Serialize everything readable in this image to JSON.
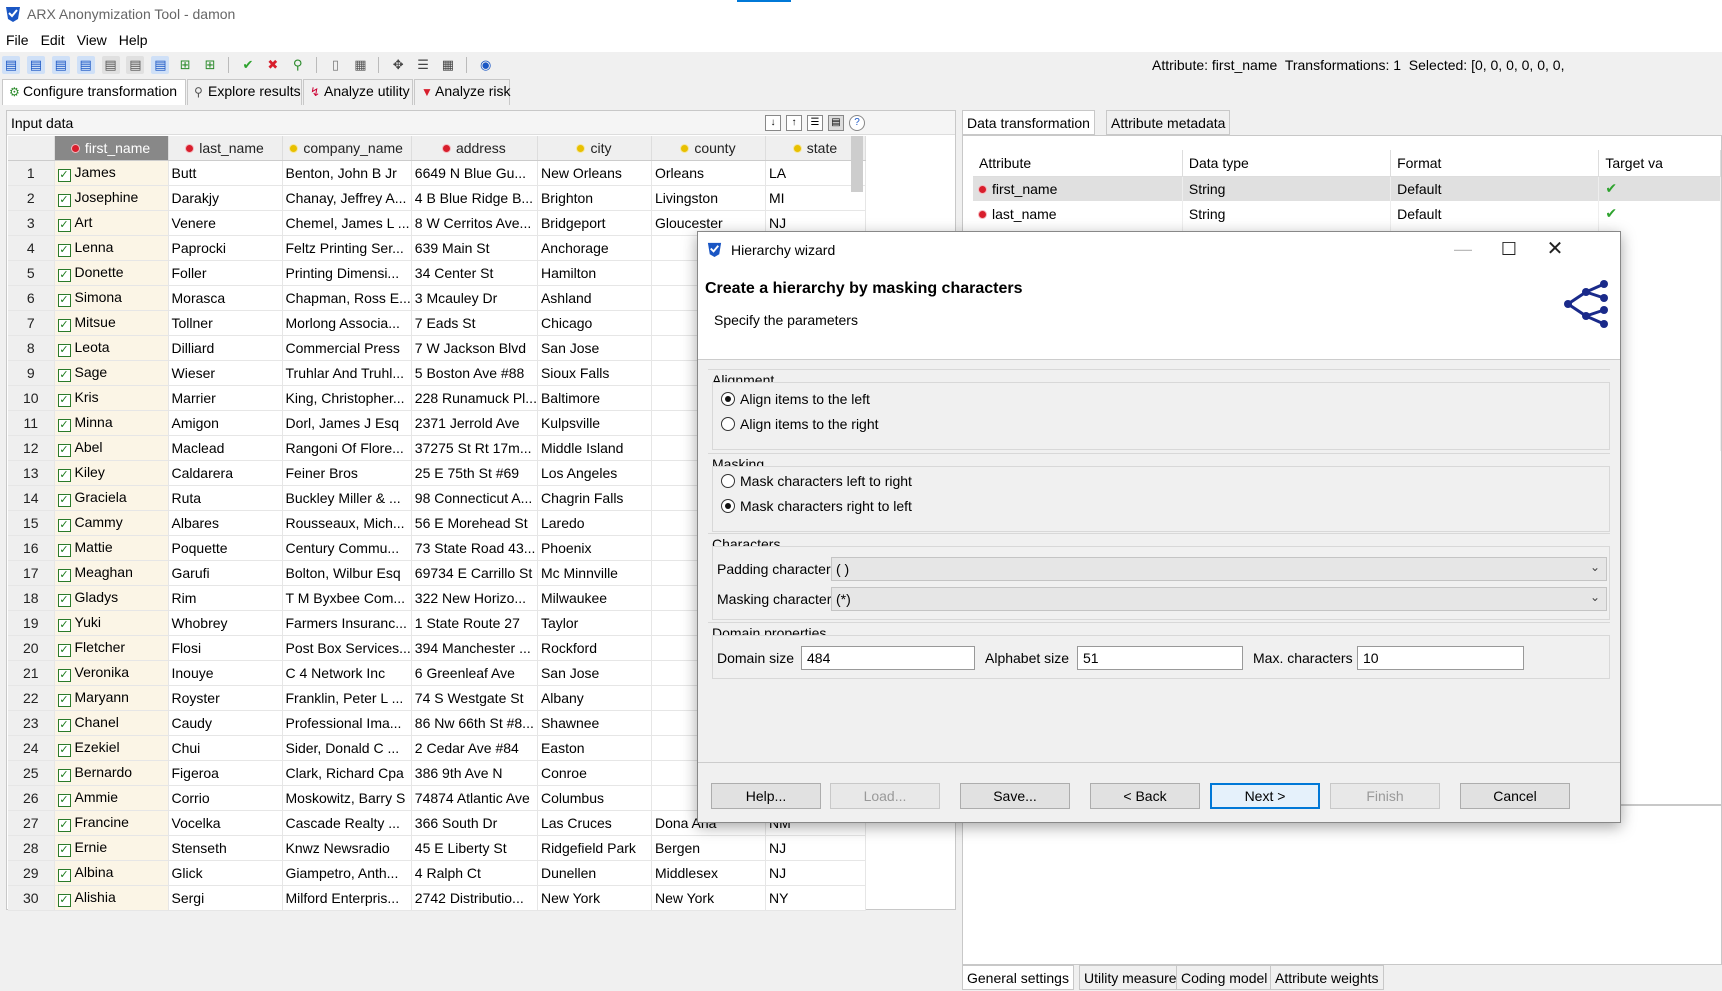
{
  "app": {
    "title": "ARX Anonymization Tool - damon"
  },
  "menu": [
    "File",
    "Edit",
    "View",
    "Help"
  ],
  "status": {
    "attribute_label": "Attribute:",
    "attribute": "first_name",
    "transformations_label": "Transformations:",
    "transformations": "1",
    "selected_label": "Selected:",
    "selected": "[0, 0, 0, 0, 0, 0,"
  },
  "perspectives": [
    "Configure transformation",
    "Explore results",
    "Analyze utility",
    "Analyze risk"
  ],
  "input": {
    "title": "Input data",
    "columns": [
      {
        "name": "first_name",
        "dot": "red"
      },
      {
        "name": "last_name",
        "dot": "red"
      },
      {
        "name": "company_name",
        "dot": "yel"
      },
      {
        "name": "address",
        "dot": "red"
      },
      {
        "name": "city",
        "dot": "yel"
      },
      {
        "name": "county",
        "dot": "yel"
      },
      {
        "name": "state",
        "dot": "yel"
      }
    ],
    "rows": [
      [
        "1",
        "James",
        "Butt",
        "Benton, John B Jr",
        "6649 N Blue Gu...",
        "New Orleans",
        "Orleans",
        "LA"
      ],
      [
        "2",
        "Josephine",
        "Darakjy",
        "Chanay, Jeffrey A...",
        "4 B Blue Ridge B...",
        "Brighton",
        "Livingston",
        "MI"
      ],
      [
        "3",
        "Art",
        "Venere",
        "Chemel, James L ...",
        "8 W Cerritos Ave...",
        "Bridgeport",
        "Gloucester",
        "NJ"
      ],
      [
        "4",
        "Lenna",
        "Paprocki",
        "Feltz Printing Ser...",
        "639 Main St",
        "Anchorage",
        "",
        ""
      ],
      [
        "5",
        "Donette",
        "Foller",
        "Printing Dimensi...",
        "34 Center St",
        "Hamilton",
        "",
        ""
      ],
      [
        "6",
        "Simona",
        "Morasca",
        "Chapman, Ross E...",
        "3 Mcauley Dr",
        "Ashland",
        "",
        ""
      ],
      [
        "7",
        "Mitsue",
        "Tollner",
        "Morlong Associa...",
        "7 Eads St",
        "Chicago",
        "",
        ""
      ],
      [
        "8",
        "Leota",
        "Dilliard",
        "Commercial Press",
        "7 W Jackson Blvd",
        "San Jose",
        "",
        ""
      ],
      [
        "9",
        "Sage",
        "Wieser",
        "Truhlar And Truhl...",
        "5 Boston Ave #88",
        "Sioux Falls",
        "",
        ""
      ],
      [
        "10",
        "Kris",
        "Marrier",
        "King, Christopher...",
        "228 Runamuck Pl...",
        "Baltimore",
        "",
        ""
      ],
      [
        "11",
        "Minna",
        "Amigon",
        "Dorl, James J Esq",
        "2371 Jerrold Ave",
        "Kulpsville",
        "",
        ""
      ],
      [
        "12",
        "Abel",
        "Maclead",
        "Rangoni Of Flore...",
        "37275 St  Rt 17m...",
        "Middle Island",
        "",
        ""
      ],
      [
        "13",
        "Kiley",
        "Caldarera",
        "Feiner Bros",
        "25 E 75th St #69",
        "Los Angeles",
        "",
        ""
      ],
      [
        "14",
        "Graciela",
        "Ruta",
        "Buckley Miller & ...",
        "98 Connecticut A...",
        "Chagrin Falls",
        "",
        ""
      ],
      [
        "15",
        "Cammy",
        "Albares",
        "Rousseaux, Mich...",
        "56 E Morehead St",
        "Laredo",
        "",
        ""
      ],
      [
        "16",
        "Mattie",
        "Poquette",
        "Century Commu...",
        "73 State Road 43...",
        "Phoenix",
        "",
        ""
      ],
      [
        "17",
        "Meaghan",
        "Garufi",
        "Bolton, Wilbur Esq",
        "69734 E Carrillo St",
        "Mc Minnville",
        "",
        ""
      ],
      [
        "18",
        "Gladys",
        "Rim",
        "T M Byxbee Com...",
        "322 New Horizo...",
        "Milwaukee",
        "",
        ""
      ],
      [
        "19",
        "Yuki",
        "Whobrey",
        "Farmers Insuranc...",
        "1 State Route 27",
        "Taylor",
        "",
        ""
      ],
      [
        "20",
        "Fletcher",
        "Flosi",
        "Post Box Services...",
        "394 Manchester ...",
        "Rockford",
        "",
        ""
      ],
      [
        "21",
        "Veronika",
        "Inouye",
        "C 4 Network Inc",
        "6 Greenleaf Ave",
        "San Jose",
        "",
        ""
      ],
      [
        "22",
        "Maryann",
        "Royster",
        "Franklin, Peter L ...",
        "74 S Westgate St",
        "Albany",
        "",
        ""
      ],
      [
        "23",
        "Chanel",
        "Caudy",
        "Professional Ima...",
        "86 Nw 66th St #8...",
        "Shawnee",
        "",
        ""
      ],
      [
        "24",
        "Ezekiel",
        "Chui",
        "Sider, Donald C ...",
        "2 Cedar Ave #84",
        "Easton",
        "",
        ""
      ],
      [
        "25",
        "Bernardo",
        "Figeroa",
        "Clark, Richard Cpa",
        "386 9th Ave N",
        "Conroe",
        "",
        ""
      ],
      [
        "26",
        "Ammie",
        "Corrio",
        "Moskowitz, Barry S",
        "74874 Atlantic Ave",
        "Columbus",
        "",
        ""
      ],
      [
        "27",
        "Francine",
        "Vocelka",
        "Cascade Realty ...",
        "366 South Dr",
        "Las Cruces",
        "Dona Ana",
        "NM"
      ],
      [
        "28",
        "Ernie",
        "Stenseth",
        "Knwz Newsradio",
        "45 E Liberty St",
        "Ridgefield Park",
        "Bergen",
        "NJ"
      ],
      [
        "29",
        "Albina",
        "Glick",
        "Giampetro, Anth...",
        "4 Ralph Ct",
        "Dunellen",
        "Middlesex",
        "NJ"
      ],
      [
        "30",
        "Alishia",
        "Sergi",
        "Milford Enterpris...",
        "2742 Distributio...",
        "New York",
        "New York",
        "NY"
      ]
    ]
  },
  "right": {
    "tabs": [
      "Data transformation",
      "Attribute metadata"
    ],
    "attr_headers": [
      "Attribute",
      "Data type",
      "Format",
      "Target va"
    ],
    "attr_rows": [
      {
        "name": "first_name",
        "type": "String",
        "format": "Default"
      },
      {
        "name": "last_name",
        "type": "String",
        "format": "Default"
      }
    ],
    "extra_checks": 9,
    "bottom_tabs": [
      "General settings",
      "Utility measure",
      "Coding model",
      "Attribute weights"
    ]
  },
  "dialog": {
    "window_title": "Hierarchy wizard",
    "title": "Create a hierarchy by masking characters",
    "subtitle": "Specify the parameters",
    "alignment": {
      "label": "Alignment",
      "left": "Align items to the left",
      "right": "Align items to the right",
      "selected": "left"
    },
    "masking": {
      "label": "Masking",
      "ltr": "Mask characters left to right",
      "rtl": "Mask characters right to left",
      "selected": "rtl"
    },
    "characters": {
      "label": "Characters",
      "padding_label": "Padding character",
      "padding_value": "( )",
      "masking_label": "Masking character",
      "masking_value": "(*)"
    },
    "domain": {
      "label": "Domain properties",
      "size_label": "Domain size",
      "size": "484",
      "alphabet_label": "Alphabet size",
      "alphabet": "51",
      "max_label": "Max. characters",
      "max": "10"
    },
    "buttons": {
      "help": "Help...",
      "load": "Load...",
      "save": "Save...",
      "back": "< Back",
      "next": "Next >",
      "finish": "Finish",
      "cancel": "Cancel"
    }
  },
  "colors": {
    "accent": "#0078d7",
    "selected_header": "#888888",
    "check": "#2ea32e",
    "icon_blue": "#1a56c4"
  }
}
